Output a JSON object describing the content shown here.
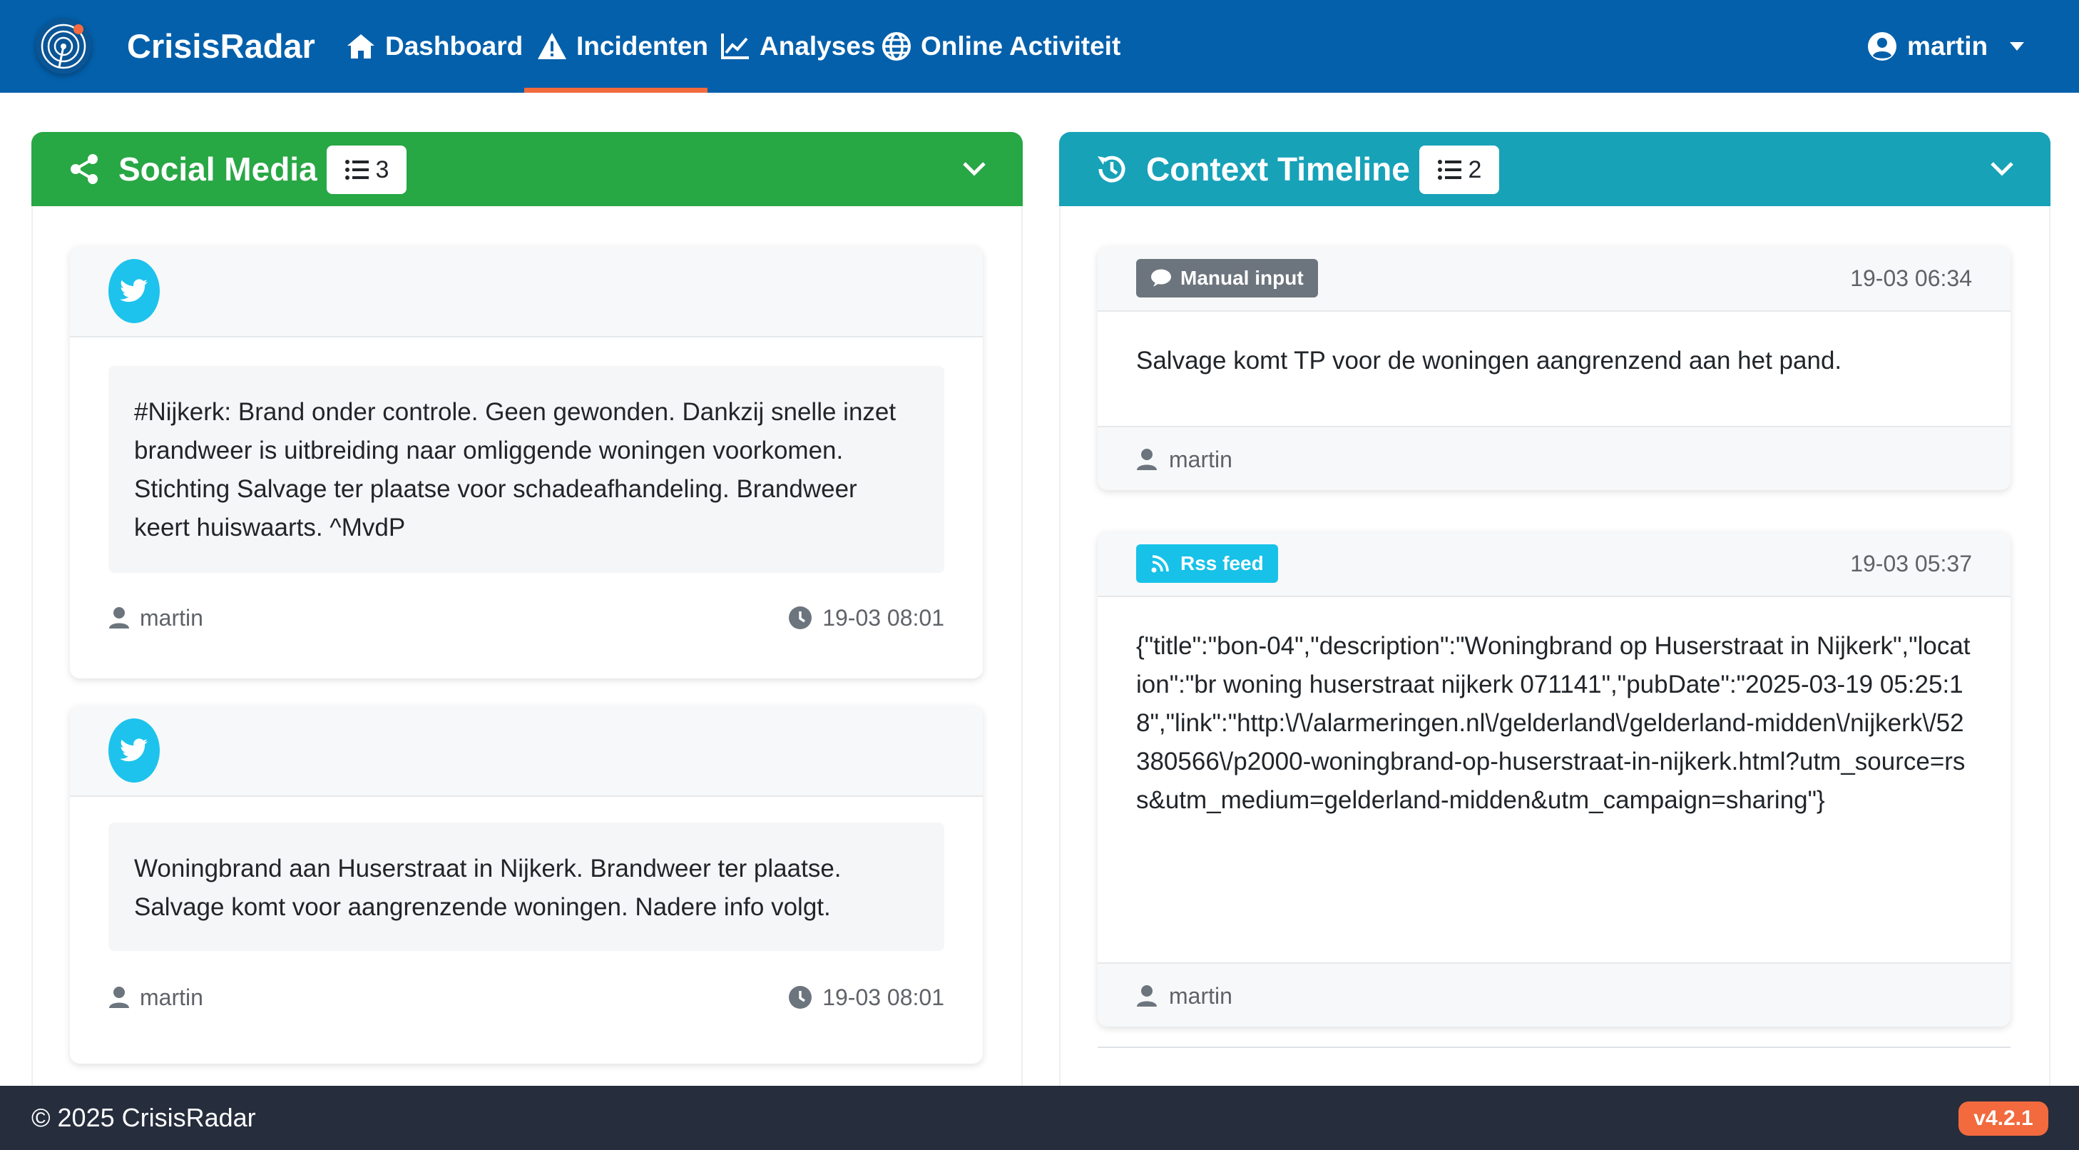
{
  "app": {
    "name": "CrisisRadar"
  },
  "nav": {
    "items": [
      {
        "label": "Dashboard",
        "icon": "home-icon"
      },
      {
        "label": "Incidenten",
        "icon": "warning-icon",
        "active": true
      },
      {
        "label": "Analyses",
        "icon": "line-chart-icon"
      },
      {
        "label": "Online Activiteit",
        "icon": "globe-icon"
      }
    ],
    "user": "martin"
  },
  "social_media": {
    "title": "Social Media",
    "count": "3",
    "posts": [
      {
        "source_icon": "twitter-icon",
        "text": "#Nijkerk: Brand onder controle. Geen gewonden. Dankzij snelle inzet brandweer is uitbreiding naar omliggende woningen voorkomen. Stichting Salvage ter plaatse voor schadeafhandeling. Brandweer keert huiswaarts. ^MvdP",
        "user": "martin",
        "time": "19-03 08:01"
      },
      {
        "source_icon": "twitter-icon",
        "text": "Woningbrand aan Huserstraat in Nijkerk. Brandweer ter plaatse. Salvage komt voor aangrenzende woningen. Nadere info volgt.",
        "user": "martin",
        "time": "19-03 08:01"
      }
    ]
  },
  "context_timeline": {
    "title": "Context Timeline",
    "count": "2",
    "entries": [
      {
        "type_label": "Manual input",
        "type_icon": "comment-icon",
        "type_color": "#6c757d",
        "time": "19-03 06:34",
        "text": "Salvage komt TP voor de woningen aangrenzend aan het pand.",
        "user": "martin"
      },
      {
        "type_label": "Rss feed",
        "type_icon": "rss-icon",
        "type_color": "#17c1e8",
        "time": "19-03 05:37",
        "text": "{\"title\":\"bon-04\",\"description\":\"Woningbrand op Huserstraat in Nijkerk\",\"location\":\"br woning huserstraat nijkerk 071141\",\"pubDate\":\"2025-03-19 05:25:18\",\"link\":\"http:\\/\\/alarmeringen.nl\\/gelderland\\/gelderland-midden\\/nijkerk\\/52380566\\/p2000-woningbrand-op-huserstraat-in-nijkerk.html?utm_source=rss&utm_medium=gelderland-midden&utm_campaign=sharing\"}",
        "user": "martin"
      }
    ]
  },
  "footer": {
    "copyright": "© 2025 CrisisRadar",
    "version": "v4.2.1"
  },
  "colors": {
    "navbar": "#0460ab",
    "accent": "#f26a3d",
    "social_header": "#28a745",
    "timeline_header": "#17a2b8",
    "footer": "#262d3d"
  }
}
